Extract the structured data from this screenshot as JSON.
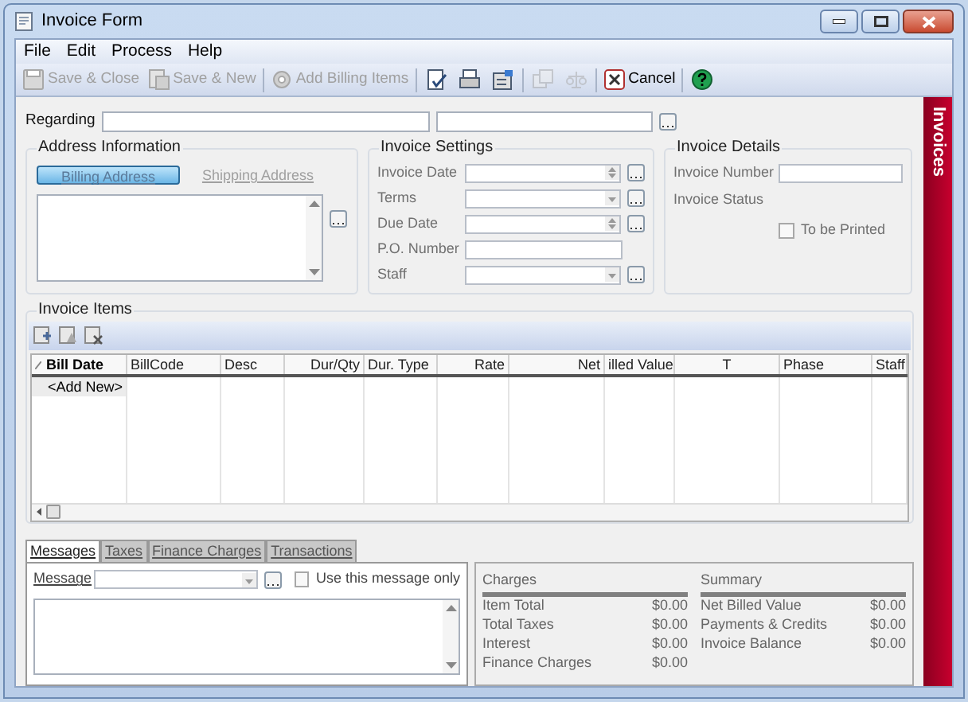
{
  "window": {
    "title": "Invoice Form"
  },
  "menu": [
    "File",
    "Edit",
    "Process",
    "Help"
  ],
  "toolbar": [
    {
      "kind": "button",
      "label": "Save & Close",
      "disabled": true
    },
    {
      "kind": "button",
      "label": "Save & New",
      "disabled": true
    },
    {
      "kind": "separator"
    },
    {
      "kind": "button",
      "label": "Add Billing Items",
      "disabled": true
    },
    {
      "kind": "separator"
    },
    {
      "kind": "icon",
      "disabled": false
    },
    {
      "kind": "icon",
      "disabled": false
    },
    {
      "kind": "icon",
      "disabled": false
    },
    {
      "kind": "separator"
    },
    {
      "kind": "icon",
      "disabled": true
    },
    {
      "kind": "icon",
      "disabled": true
    },
    {
      "kind": "separator"
    },
    {
      "kind": "button",
      "label": "Cancel",
      "disabled": false
    },
    {
      "kind": "separator"
    },
    {
      "kind": "icon",
      "disabled": false
    }
  ],
  "regarding": {
    "label": "Regarding"
  },
  "address": {
    "title": "Address Information",
    "tabs": [
      {
        "label": "Billing Address",
        "selected": true
      },
      {
        "label": "Shipping Address",
        "selected": false
      }
    ]
  },
  "settings": {
    "title": "Invoice Settings",
    "fields": [
      {
        "label": "Invoice Date",
        "kind": "spin",
        "lookup": true
      },
      {
        "label": "Terms",
        "kind": "combo",
        "lookup": true
      },
      {
        "label": "Due Date",
        "kind": "spin",
        "lookup": true
      },
      {
        "label": "P.O. Number",
        "kind": "text",
        "lookup": false
      },
      {
        "label": "Staff",
        "kind": "combo",
        "lookup": true
      }
    ]
  },
  "details": {
    "title": "Invoice Details",
    "fields": [
      {
        "label": "Invoice Number",
        "kind": "text"
      },
      {
        "label": "Invoice Status",
        "kind": "static"
      }
    ],
    "to_be_printed": {
      "label": "To be Printed",
      "checked": false
    }
  },
  "side_tab": {
    "label": "Invoices"
  },
  "items": {
    "title": "Invoice Items",
    "columns": [
      "Bill Date",
      "BillCode",
      "Desc",
      "Dur/Qty",
      "Dur. Type",
      "Rate",
      "Net",
      "illed Value",
      "T",
      "Phase",
      "Staff"
    ],
    "new_row": "<Add New>"
  },
  "bottom_tabs": [
    {
      "label": "Messages",
      "selected": true
    },
    {
      "label": "Taxes",
      "selected": false
    },
    {
      "label": "Finance Charges",
      "selected": false
    },
    {
      "label": "Transactions",
      "selected": false
    }
  ],
  "message": {
    "label": "Message",
    "use_only": {
      "label": "Use this message only",
      "checked": false
    }
  },
  "charges": {
    "title": "Charges",
    "rows": [
      {
        "label": "Item Total",
        "value": "$0.00"
      },
      {
        "label": "Total Taxes",
        "value": "$0.00"
      },
      {
        "label": "Interest",
        "value": "$0.00"
      },
      {
        "label": "Finance Charges",
        "value": "$0.00"
      }
    ]
  },
  "summary": {
    "title": "Summary",
    "rows": [
      {
        "label": "Net Billed Value",
        "value": "$0.00"
      },
      {
        "label": "Payments & Credits",
        "value": "$0.00"
      },
      {
        "label": "Invoice Balance",
        "value": "$0.00"
      }
    ]
  }
}
